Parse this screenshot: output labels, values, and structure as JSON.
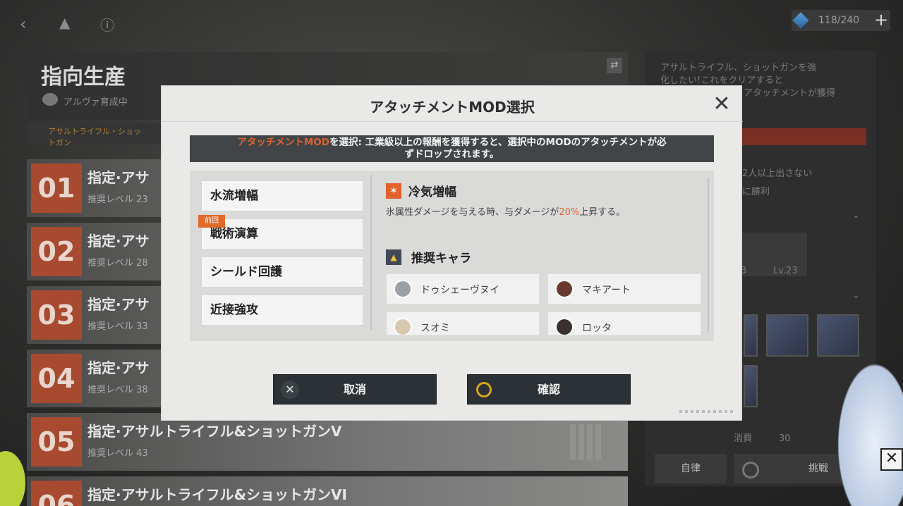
{
  "background": {
    "resource_count": "118/240",
    "page_title": "指向生産",
    "subtitle": "アルヴァ育成中",
    "strip_text": "アサルトライフル・ショットガン",
    "rows": [
      {
        "num": "01",
        "title": "指定·アサ",
        "level": "推奨レベル 23"
      },
      {
        "num": "02",
        "title": "指定·アサ",
        "level": "推奨レベル 28"
      },
      {
        "num": "03",
        "title": "指定·アサ",
        "level": "推奨レベル 33"
      },
      {
        "num": "04",
        "title": "指定·アサ",
        "level": "推奨レベル 38"
      },
      {
        "num": "05",
        "title": "指定·アサルトライフル&ショットガンV",
        "level": "推奨レベル 43"
      },
      {
        "num": "06",
        "title": "指定·アサルトライフル&ショットガンVI",
        "level": ""
      }
    ],
    "right_panel": {
      "desc_line1": "アサルトライフル、ショットガンを強",
      "desc_line2": "化したい!これをクリアすると",
      "desc_line3": "アタッチメントが獲得",
      "cond_line1": "2人以上出さない",
      "cond_line2": "に勝利",
      "level_a": "3",
      "level_b": "Lv.23",
      "cost_label": "消費",
      "cost_value": "30",
      "auto_button": "自律",
      "challenge_button": "挑戦"
    }
  },
  "modal": {
    "title": "アタッチメントMOD選択",
    "notice_highlight": "アタッチメントMOD",
    "notice_rest_line1": "を選択: 工業級以上の報酬を獲得すると、選択中のMODのアタッチメントが必",
    "notice_line2": "ずドロップされます。",
    "options": [
      "水流増幅",
      "戦術演算",
      "シールド回護",
      "近接強攻"
    ],
    "previous_badge": "前回",
    "selected": {
      "name": "冷気増幅",
      "desc_before": "氷属性ダメージを与える時、与ダメージが",
      "desc_value": "20%",
      "desc_after": "上昇する。"
    },
    "recommended_label": "推奨キャラ",
    "characters": [
      "ドゥシェーヴヌイ",
      "マキアート",
      "スオミ",
      "ロッタ"
    ],
    "cancel_button": "取消",
    "confirm_button": "確認"
  },
  "colors": {
    "accent": "#e0622c",
    "row_number": "#a84a30",
    "button_dark": "#2b3134",
    "confirm_ring": "#d6a41e"
  }
}
